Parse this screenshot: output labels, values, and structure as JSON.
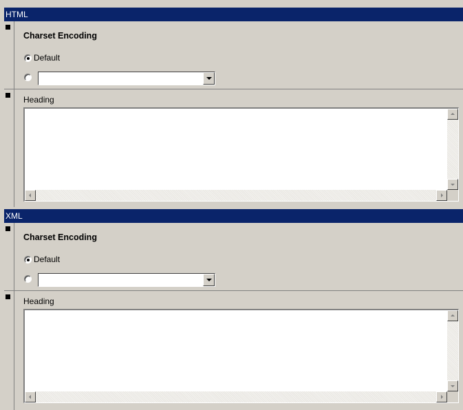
{
  "sections": [
    {
      "title": "HTML",
      "charset": {
        "title": "Charset Encoding",
        "default_option": "Default",
        "custom_value": ""
      },
      "heading": {
        "label": "Heading",
        "value": ""
      }
    },
    {
      "title": "XML",
      "charset": {
        "title": "Charset Encoding",
        "default_option": "Default",
        "custom_value": ""
      },
      "heading": {
        "label": "Heading",
        "value": ""
      }
    }
  ],
  "icons": {
    "bullet": "group-marker-icon",
    "combo": "chevron-down-icon",
    "scroll": [
      "arrow-up-icon",
      "arrow-down-icon",
      "arrow-left-icon",
      "arrow-right-icon"
    ]
  },
  "colors": {
    "header_bg": "#0a246a",
    "panel_bg": "#d4d0c8"
  }
}
